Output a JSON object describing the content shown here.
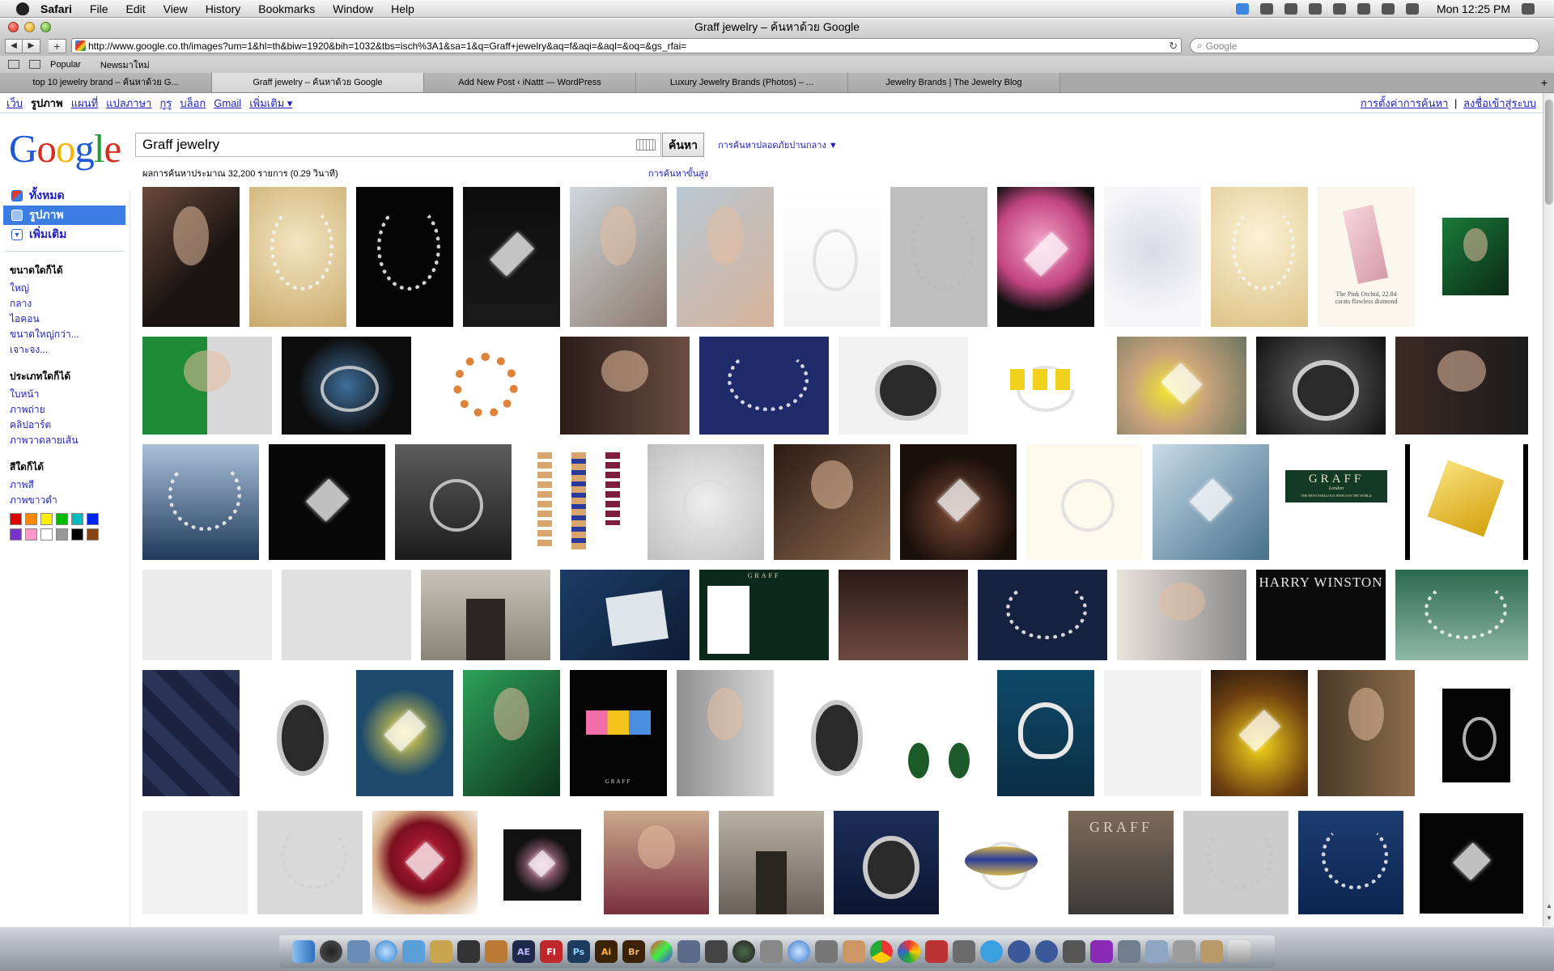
{
  "menubar": {
    "app": "Safari",
    "items": [
      "File",
      "Edit",
      "View",
      "History",
      "Bookmarks",
      "Window",
      "Help"
    ],
    "clock": "Mon 12:25 PM"
  },
  "window": {
    "title": "Graff jewelry – ค้นหาด้วย Google",
    "url": "http://www.google.co.th/images?um=1&hl=th&biw=1920&bih=1032&tbs=isch%3A1&sa=1&q=Graff+jewelry&aq=f&aqi=&aql=&oq=&gs_rfai=",
    "search_placeholder": "Google"
  },
  "bookmarks": [
    "Popular",
    "Newsมาใหม่"
  ],
  "tabs": [
    {
      "label": "top 10 jewelry brand – ค้นหาด้วย G..."
    },
    {
      "label": "Graff jewelry – ค้นหาด้วย Google",
      "active": true
    },
    {
      "label": "Add New Post ‹ iNattt — WordPress"
    },
    {
      "label": "Luxury Jewelry Brands (Photos) – ..."
    },
    {
      "label": "Jewelry Brands | The Jewelry Blog"
    }
  ],
  "gbar": {
    "links": [
      "เว็บ",
      "รูปภาพ",
      "แผนที่",
      "แปลภาษา",
      "กูรู",
      "บล็อก",
      "Gmail",
      "เพิ่มเติม ▾"
    ],
    "settings": "การตั้งค่าการค้นหา",
    "signin": "ลงชื่อเข้าสู่ระบบ",
    "separator": "|"
  },
  "logo": [
    "G",
    "o",
    "o",
    "g",
    "l",
    "e"
  ],
  "search": {
    "query": "Graff jewelry",
    "button": "ค้นหา",
    "safe_search": "การค้นหาปลอดภัยปานกลาง ▼",
    "stats": "ผลการค้นหาประมาณ 32,200 รายการ (0.29 วินาที)",
    "advanced": "การค้นหาขั้นสูง"
  },
  "sidebar": {
    "types": [
      {
        "label": "ทั้งหมด",
        "icon": "all-results-icon"
      },
      {
        "label": "รูปภาพ",
        "icon": "images-icon",
        "selected": true
      },
      {
        "label": "เพิ่มเติม",
        "icon": "expand-icon"
      }
    ],
    "sections": [
      {
        "heading": "ขนาดใดก็ได้",
        "links": [
          "ใหญ่",
          "กลาง",
          "ไอคอน",
          "ขนาดใหญ่กว่า...",
          "เจาะจง..."
        ]
      },
      {
        "heading": "ประเภทใดก็ได้",
        "links": [
          "ใบหน้า",
          "ภาพถ่าย",
          "คลิปอาร์ต",
          "ภาพวาดลายเส้น"
        ]
      },
      {
        "heading": "สีใดก็ได้",
        "links": [
          "ภาพสี",
          "ภาพขาวดำ"
        ]
      }
    ],
    "colors": [
      "#dd0000",
      "#ff8800",
      "#ffee00",
      "#00bb00",
      "#00bbbb",
      "#0022ee",
      "#7733cc",
      "#ff99cc",
      "#ffffff",
      "#999999",
      "#000000",
      "#884411"
    ]
  },
  "thumb_labels": {
    "graff_logo": "GRAFF",
    "graff_sub": "London",
    "graff_tag": "THE MOST FABULOUS JEWELS IN THE WORLD",
    "harry_winston": "HARRY WINSTON",
    "pink_orchid": "The Pink Orchid, 22.84 carats flawless diamond",
    "graff_box": "GRAFF",
    "graff_ad": "GRAFF"
  },
  "dock": [
    "AE",
    "Fl",
    "Ps",
    "Ai",
    "Br"
  ]
}
